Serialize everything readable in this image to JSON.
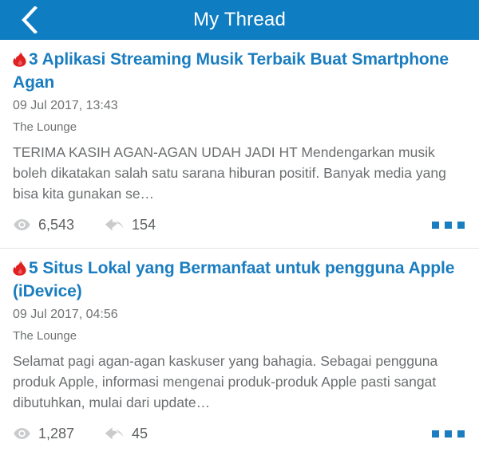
{
  "header": {
    "title": "My Thread",
    "back_icon": "chevron-left-icon",
    "background_color": "#0f7dc2",
    "title_color": "#ffffff"
  },
  "colors": {
    "title_link": "#1a7dc0",
    "flame": "#e02020",
    "meta_text": "#6f7274",
    "body_text": "#6b6e70",
    "divider": "#e2e4e6"
  },
  "threads": [
    {
      "hot_icon": "flame-icon",
      "title": "3 Aplikasi Streaming Musik Terbaik Buat Smartphone Agan",
      "date": "09 Jul 2017, 13:43",
      "forum": "The Lounge",
      "excerpt": "TERIMA KASIH AGAN-AGAN UDAH JADI HT Mendengarkan musik boleh dikatakan salah satu sarana hiburan positif. Banyak media yang bisa kita gunakan se…",
      "views_icon": "eye-icon",
      "views": "6,543",
      "replies_icon": "reply-arrow-icon",
      "replies": "154",
      "overflow_icon": "more-options-icon"
    },
    {
      "hot_icon": "flame-icon",
      "title": "5 Situs Lokal yang Bermanfaat untuk pengguna Apple (iDevice)",
      "date": "09 Jul 2017, 04:56",
      "forum": "The Lounge",
      "excerpt": "Selamat pagi agan-agan kaskuser yang bahagia. Sebagai pengguna produk Apple, informasi mengenai produk-produk Apple pasti sangat dibutuhkan, mulai dari update…",
      "views_icon": "eye-icon",
      "views": "1,287",
      "replies_icon": "reply-arrow-icon",
      "replies": "45",
      "overflow_icon": "more-options-icon"
    }
  ]
}
